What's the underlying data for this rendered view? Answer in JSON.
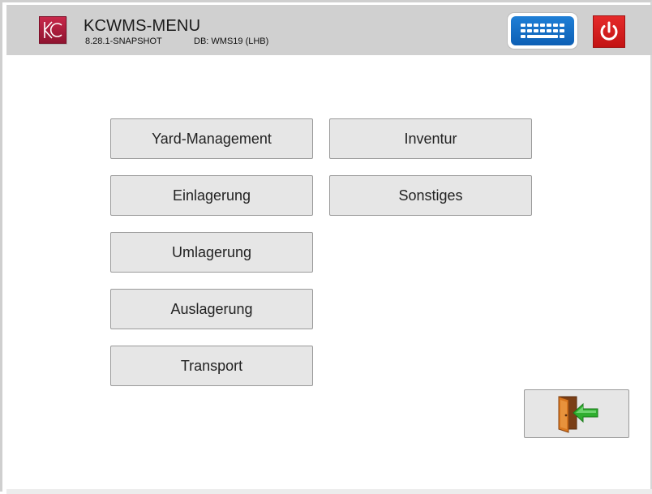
{
  "header": {
    "title": "KCWMS-MENU",
    "version": "8.28.1-SNAPSHOT",
    "database": "DB: WMS19 (LHB)",
    "logo_text": "KC"
  },
  "toolbar": {
    "keyboard_icon": "keyboard-icon",
    "power_icon": "power-icon"
  },
  "menu": {
    "left": [
      {
        "label": "Yard-Management"
      },
      {
        "label": "Einlagerung"
      },
      {
        "label": "Umlagerung"
      },
      {
        "label": "Auslagerung"
      },
      {
        "label": "Transport"
      }
    ],
    "right": [
      {
        "label": "Inventur"
      },
      {
        "label": "Sonstiges"
      }
    ]
  },
  "exit": {
    "icon": "exit-door-icon"
  },
  "colors": {
    "header_bg": "#d0d0d0",
    "button_bg": "#e6e6e6",
    "brand_red": "#b01c3c",
    "keyboard_blue": "#1570c8",
    "power_red": "#d81c1c"
  }
}
